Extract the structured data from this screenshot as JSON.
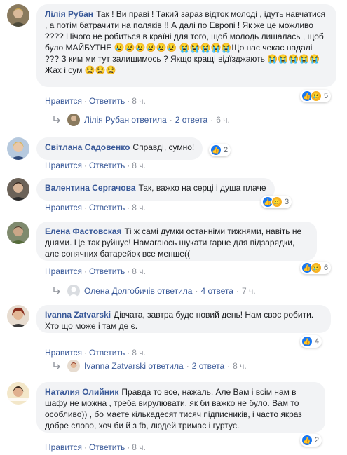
{
  "labels": {
    "like": "Нравится",
    "reply": "Ответить",
    "sep": "·"
  },
  "comments": [
    {
      "author": "Лілія Рубан",
      "text": "Так ! Ви праві ! Такий зараз відток молоді , ідуть навчатися , а потім батрачити на поляків !! А далі по Европі ! Як же це можливо ???? Нічого не робиться в країні для того, щоб молодь лишалась , щоб було МАЙБУТНЕ 😢😢😢😢😢😢 😭😭😭😭😭Що нас чекає надалі ??? З ким ми тут залишимось ? Якщо кращі відїзджають 😭😭😭😭😭Жах і сум 😫😫😫",
      "reaction_count": "5",
      "time": "8 ч.",
      "replies": {
        "name": "Лілія Рубан",
        "verb": "ответила",
        "count": "2 ответа",
        "time": "6 ч."
      }
    },
    {
      "author": "Світлана Садовенко",
      "text": "Справді, сумно!",
      "reaction_count": "2",
      "time": "8 ч."
    },
    {
      "author": "Валентина Сергачова",
      "text": "Так, важко на серці і душа плаче",
      "reaction_count": "3",
      "time": "8 ч."
    },
    {
      "author": "Елена Фастовская",
      "text": "Ті ж самі думки останніми тижнями, навіть не днями. Це так руйнує! Намагаюсь шукати гарне для підзарядки, але сонячних батарейок все менше((",
      "reaction_count": "6",
      "time": "8 ч.",
      "replies": {
        "name": "Олена Долгобичів",
        "verb": "ответила",
        "count": "4 ответа",
        "time": "7 ч."
      }
    },
    {
      "author": "Ivanna Zatvarski",
      "text": "Дівчата, завтра буде новий день! Нам своє робити. Хто що може і там де є.",
      "reaction_count": "4",
      "time": "8 ч.",
      "replies": {
        "name": "Ivanna Zatvarski",
        "verb": "ответила",
        "count": "2 ответа",
        "time": "8 ч."
      }
    },
    {
      "author": "Наталия Олийник",
      "text": "Правда то все, нажаль. Але Вам і всім нам в шафу не можна , треба вирулювати, як би важко не було. Вам то особливо)) , бо маєте кількадесят тисяч підписників, і часто якраз добре слово, хоч би й з fb, людей тримає і гуртує.",
      "reaction_count": "2",
      "time": "8 ч."
    }
  ],
  "colors": {
    "link": "#385898",
    "bubble": "#f2f3f5",
    "meta": "#90949c"
  },
  "icons": {
    "reply": "reply-arrow-icon",
    "like": "like-reaction-icon",
    "sad": "sad-reaction-icon"
  }
}
